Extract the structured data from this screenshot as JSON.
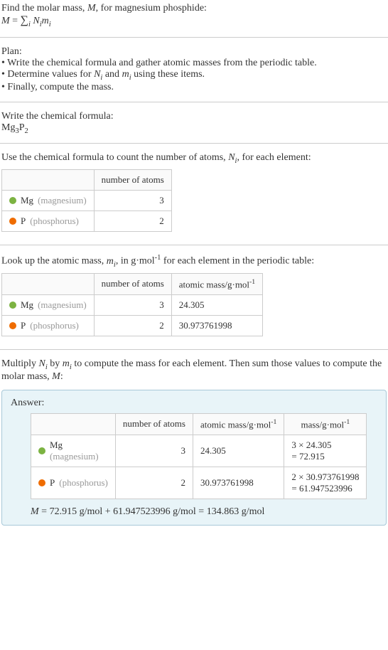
{
  "intro": {
    "line1_a": "Find the molar mass, ",
    "line1_b": ", for magnesium phosphide:",
    "line2": "M = ∑",
    "line2_sub": "i",
    "line2_tail": " Nᵢmᵢ"
  },
  "plan": {
    "heading": "Plan:",
    "items": [
      "• Write the chemical formula and gather atomic masses from the periodic table.",
      "• Determine values for Nᵢ and mᵢ using these items.",
      "• Finally, compute the mass."
    ]
  },
  "write_formula": {
    "heading": "Write the chemical formula:",
    "formula_base": "Mg",
    "formula_sub1": "3",
    "formula_mid": "P",
    "formula_sub2": "2"
  },
  "count_atoms": {
    "heading_a": "Use the chemical formula to count the number of atoms, ",
    "heading_b": ", for each element:",
    "th_atoms": "number of atoms",
    "rows": [
      {
        "sym": "Mg",
        "name": "(magnesium)",
        "n": "3"
      },
      {
        "sym": "P",
        "name": "(phosphorus)",
        "n": "2"
      }
    ]
  },
  "atomic_mass": {
    "heading_a": "Look up the atomic mass, ",
    "heading_b": ", in g·mol",
    "heading_c": " for each element in the periodic table:",
    "th_atoms": "number of atoms",
    "th_mass": "atomic mass/g·mol",
    "rows": [
      {
        "sym": "Mg",
        "name": "(magnesium)",
        "n": "3",
        "m": "24.305"
      },
      {
        "sym": "P",
        "name": "(phosphorus)",
        "n": "2",
        "m": "30.973761998"
      }
    ]
  },
  "multiply": {
    "heading_a": "Multiply ",
    "heading_b": " by ",
    "heading_c": " to compute the mass for each element. Then sum those values to compute the molar mass, ",
    "heading_d": ":"
  },
  "answer": {
    "label": "Answer:",
    "th_atoms": "number of atoms",
    "th_amass": "atomic mass/g·mol",
    "th_mass": "mass/g·mol",
    "rows": [
      {
        "sym": "Mg",
        "name": "(magnesium)",
        "n": "3",
        "m": "24.305",
        "calc1": "3 × 24.305",
        "calc2": "= 72.915"
      },
      {
        "sym": "P",
        "name": "(phosphorus)",
        "n": "2",
        "m": "30.973761998",
        "calc1": "2 × 30.973761998",
        "calc2": "= 61.947523996"
      }
    ],
    "final": "M = 72.915 g/mol + 61.947523996 g/mol = 134.863 g/mol"
  },
  "chart_data": {
    "type": "table",
    "title": "Molar mass of magnesium phosphide Mg3P2",
    "series": [
      {
        "name": "Mg",
        "number_of_atoms": 3,
        "atomic_mass_g_per_mol": 24.305,
        "mass_g_per_mol": 72.915
      },
      {
        "name": "P",
        "number_of_atoms": 2,
        "atomic_mass_g_per_mol": 30.973761998,
        "mass_g_per_mol": 61.947523996
      }
    ],
    "total_molar_mass_g_per_mol": 134.863
  }
}
